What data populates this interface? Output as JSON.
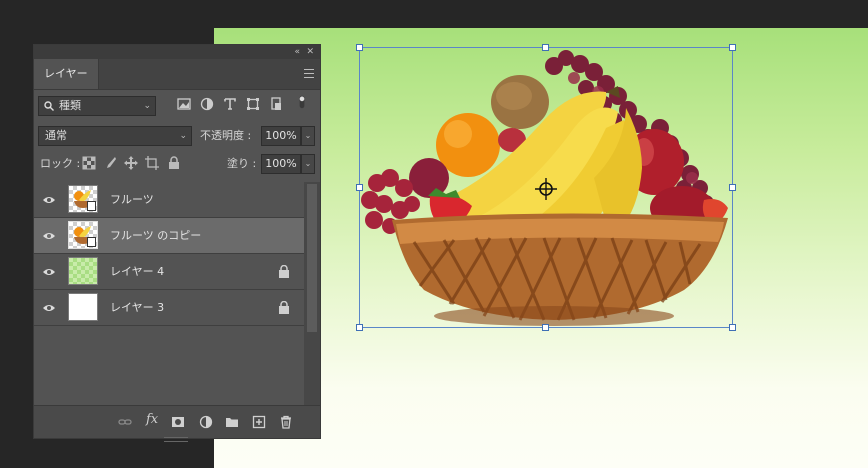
{
  "panel": {
    "tab_label": "レイヤー",
    "collapse_glyph": "«",
    "close_glyph": "✕",
    "filter": {
      "label": "種類",
      "icon": "search-icon"
    },
    "blend_mode": "通常",
    "opacity": {
      "label": "不透明度 :",
      "value": "100%"
    },
    "lock": {
      "label": "ロック :"
    },
    "fill": {
      "label": "塗り :",
      "value": "100%"
    },
    "layers": [
      {
        "name": "フルーツ",
        "thumb": "fruit-smart-object",
        "locked": false,
        "active": false,
        "visible": true
      },
      {
        "name": "フルーツ のコピー",
        "thumb": "fruit-smart-object",
        "locked": false,
        "active": true,
        "visible": true
      },
      {
        "name": "レイヤー 4",
        "thumb": "green-transparent",
        "locked": true,
        "active": false,
        "visible": true
      },
      {
        "name": "レイヤー 3",
        "thumb": "white",
        "locked": true,
        "active": false,
        "visible": true
      }
    ],
    "bottom_icons": [
      "link-icon",
      "fx-icon",
      "mask-icon",
      "adjustment-icon",
      "folder-icon",
      "new-layer-icon",
      "trash-icon"
    ],
    "fx_label": "fx"
  },
  "canvas": {
    "gradient_top": "#a7e07a",
    "gradient_bottom": "#fdfef6",
    "selection_color": "#5a86c8"
  }
}
